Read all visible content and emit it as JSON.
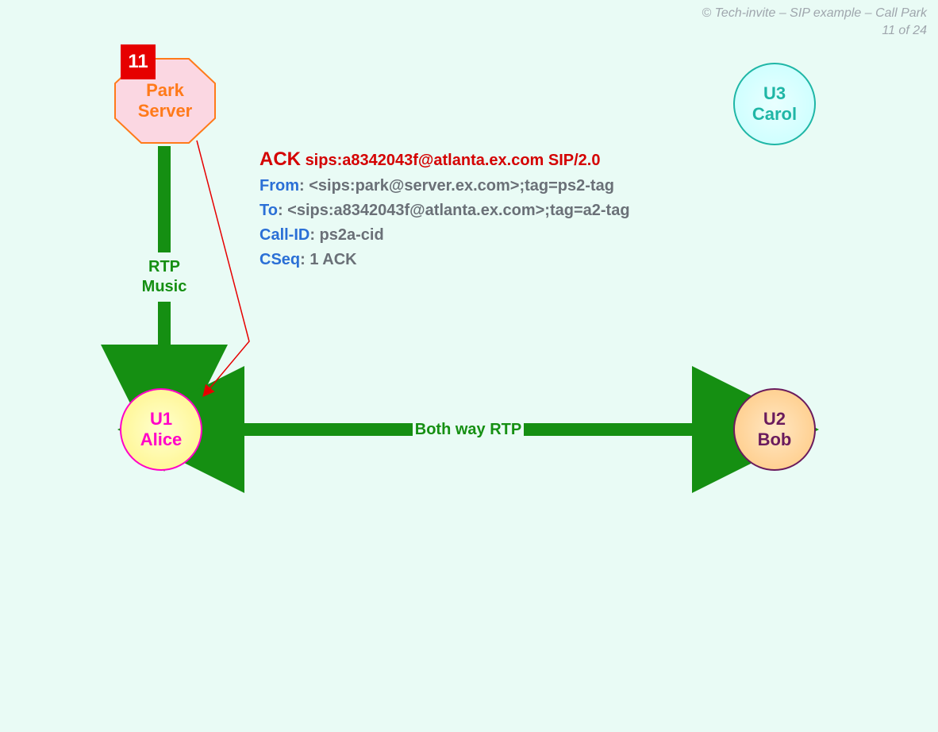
{
  "header": {
    "copyright": "© Tech-invite – SIP example – Call Park",
    "page_counter": "11 of 24"
  },
  "step": {
    "number": "11"
  },
  "nodes": {
    "park_server": {
      "line1": "Park",
      "line2": "Server"
    },
    "u1": {
      "line1": "U1",
      "line2": "Alice"
    },
    "u2": {
      "line1": "U2",
      "line2": "Bob"
    },
    "u3": {
      "line1": "U3",
      "line2": "Carol"
    }
  },
  "labels": {
    "rtp_music_line1": "RTP",
    "rtp_music_line2": "Music",
    "both_way_rtp": "Both way RTP"
  },
  "sip": {
    "method": "ACK",
    "request_uri": "sips:a8342043f@atlanta.ex.com SIP/2.0",
    "from_label": "From",
    "from_value": ": <sips:park@server.ex.com>;tag=ps2-tag",
    "to_label": "To",
    "to_value": ": <sips:a8342043f@atlanta.ex.com>;tag=a2-tag",
    "callid_label": "Call-ID",
    "callid_value": ": ps2a-cid",
    "cseq_label": "CSeq",
    "cseq_value": ": 1 ACK"
  },
  "colors": {
    "green": "#158f12",
    "red": "#d40000",
    "orange": "#ff7a1a"
  }
}
